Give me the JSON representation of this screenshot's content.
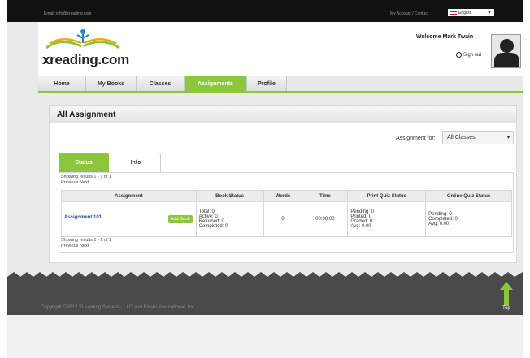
{
  "topbar": {
    "email": "Email: info@xreading.com",
    "links": "My Account / Contact",
    "language": "English"
  },
  "header": {
    "logo_text": "xreading.com",
    "welcome": "Welcome Mark Twain",
    "signout": "Sign out"
  },
  "nav": {
    "tabs": [
      {
        "label": "Home"
      },
      {
        "label": "My Books"
      },
      {
        "label": "Classes"
      },
      {
        "label": "Assignments"
      },
      {
        "label": "Profile"
      }
    ],
    "active": "Assignments"
  },
  "card": {
    "title": "All Assignment",
    "assignment_for_label": "Assignment for:",
    "assignment_for_value": "All Classes",
    "tabs": [
      {
        "label": "Status"
      },
      {
        "label": "Info"
      }
    ],
    "showing_top": "Showing results 1 - 1 of 1",
    "pager_top": "Previous Next",
    "showing_bottom": "Showing results 1 - 1 of 1",
    "pager_bottom": "Previous Next",
    "columns": [
      "Assignment",
      "Book Status",
      "Words",
      "Time",
      "Print Quiz Status",
      "Online Quiz Status"
    ],
    "row": {
      "assignment": "Assignment 101",
      "add_book": "Add Book",
      "book_status": [
        "Total: 0",
        "Active: 0",
        "Returned: 0",
        "Completed: 0"
      ],
      "words": "0",
      "time": "00:00:00",
      "print_quiz": [
        "Pending: 0",
        "Printed: 0",
        "Graded: 0",
        "Avg: 0.00"
      ],
      "online_quiz": [
        "Pending: 0",
        "Completed: 0",
        "Avg: 0.00"
      ]
    }
  },
  "footer": {
    "copyright": "Copyright ©2012 XLearning Systems, LLC and Enishi International, Inc.",
    "top_label": "Top"
  },
  "colors": {
    "accent": "#8cc63f",
    "link": "#2a4bb5",
    "dark": "#111111"
  }
}
